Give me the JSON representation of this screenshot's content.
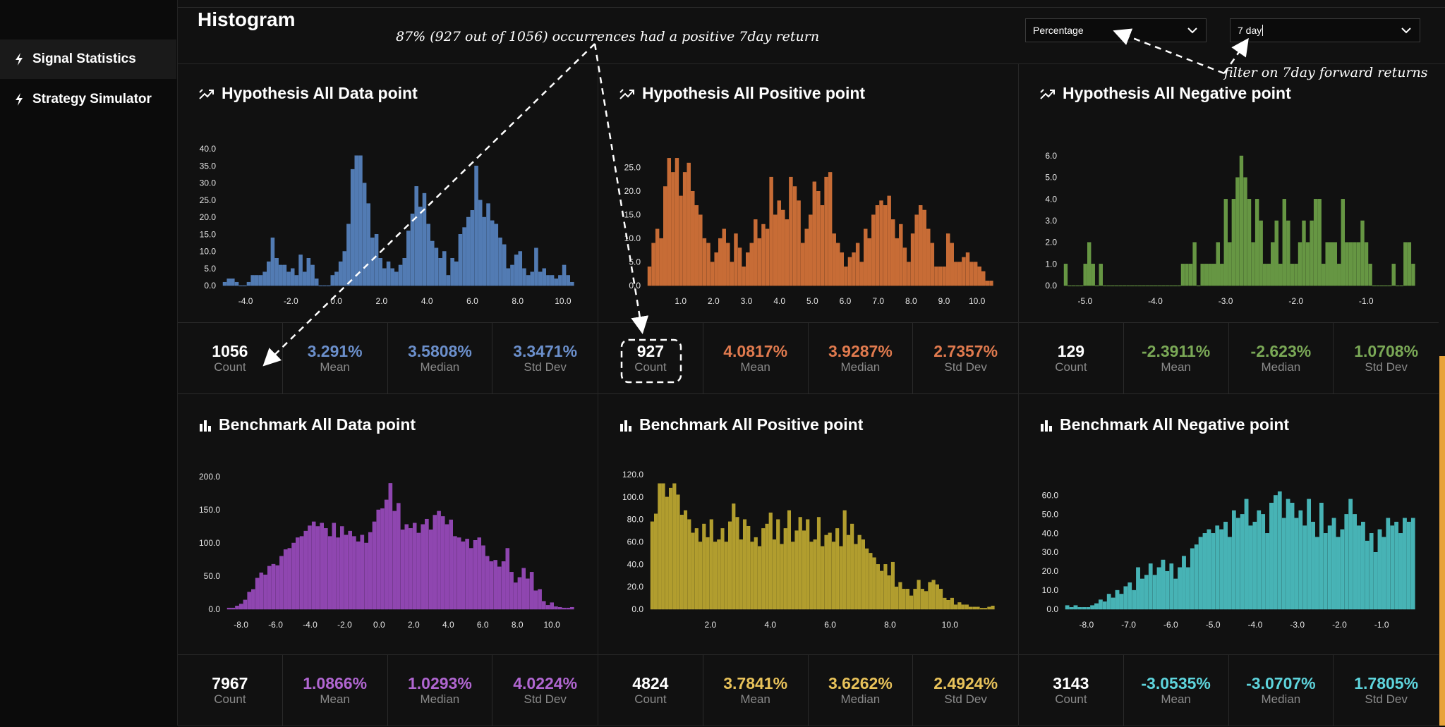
{
  "sidebar": {
    "items": [
      {
        "label": "Signal Statistics",
        "icon": "bolt-icon",
        "active": true
      },
      {
        "label": "Strategy Simulator",
        "icon": "bolt-icon",
        "active": false
      }
    ]
  },
  "header": {
    "title": "Histogram",
    "mode_select": {
      "value": "Percentage"
    },
    "period_select": {
      "value": "7 day"
    }
  },
  "annotations": {
    "occurrences": "87% (927 out of 1056) occurrences had a positive 7day return",
    "filter": "filter on 7day forward returns"
  },
  "colors": {
    "blue": "#5b8ac9",
    "orange": "#e0793b",
    "green": "#72a84a",
    "purple": "#a04dc6",
    "yellow": "#c7b132",
    "cyan": "#4fc9cc",
    "blue_text": "#6b8fcb",
    "orange_text": "#e07a4e",
    "green_text": "#7aa856",
    "purple_text": "#b066d0",
    "yellow_text": "#e8c25a",
    "cyan_text": "#5ed4dc"
  },
  "panels": [
    {
      "title": "Hypothesis All Data point",
      "icon": "trend-icon",
      "stats": {
        "count": "1056",
        "count_label": "Count",
        "mean": "3.291%",
        "mean_label": "Mean",
        "median": "3.5808%",
        "median_label": "Median",
        "std": "3.3471%",
        "std_label": "Std Dev"
      }
    },
    {
      "title": "Hypothesis All Positive point",
      "icon": "trend-icon",
      "stats": {
        "count": "927",
        "count_label": "Count",
        "mean": "4.0817%",
        "mean_label": "Mean",
        "median": "3.9287%",
        "median_label": "Median",
        "std": "2.7357%",
        "std_label": "Std Dev"
      }
    },
    {
      "title": "Hypothesis All Negative point",
      "icon": "trend-icon",
      "stats": {
        "count": "129",
        "count_label": "Count",
        "mean": "-2.3911%",
        "mean_label": "Mean",
        "median": "-2.623%",
        "median_label": "Median",
        "std": "1.0708%",
        "std_label": "Std Dev"
      }
    },
    {
      "title": "Benchmark All Data point",
      "icon": "bar-chart-icon",
      "stats": {
        "count": "7967",
        "count_label": "Count",
        "mean": "1.0866%",
        "mean_label": "Mean",
        "median": "1.0293%",
        "median_label": "Median",
        "std": "4.0224%",
        "std_label": "Std Dev"
      }
    },
    {
      "title": "Benchmark All Positive point",
      "icon": "bar-chart-icon",
      "stats": {
        "count": "4824",
        "count_label": "Count",
        "mean": "3.7841%",
        "mean_label": "Mean",
        "median": "3.6262%",
        "median_label": "Median",
        "std": "2.4924%",
        "std_label": "Std Dev"
      }
    },
    {
      "title": "Benchmark All Negative point",
      "icon": "bar-chart-icon",
      "stats": {
        "count": "3143",
        "count_label": "Count",
        "mean": "-3.0535%",
        "mean_label": "Mean",
        "median": "-3.0707%",
        "median_label": "Median",
        "std": "1.7805%",
        "std_label": "Std Dev"
      }
    }
  ],
  "chart_data": [
    {
      "type": "bar",
      "color": "#5b8ac9",
      "x_range": [
        -5.0,
        10.5
      ],
      "x_ticks": [
        "-4.0",
        "-2.0",
        "0.0",
        "2.0",
        "4.0",
        "6.0",
        "8.0",
        "10.0"
      ],
      "x_tick_values": [
        -4,
        -2,
        0,
        2,
        4,
        6,
        8,
        10
      ],
      "y_ticks": [
        "0.0",
        "5.0",
        "10.0",
        "15.0",
        "20.0",
        "25.0",
        "30.0",
        "35.0",
        "40.0"
      ],
      "y_tick_values": [
        0,
        5,
        10,
        15,
        20,
        25,
        30,
        35,
        40
      ],
      "ylim": [
        0,
        40
      ],
      "values": [
        1,
        2,
        2,
        1,
        0,
        0,
        1,
        3,
        3,
        3,
        4,
        7,
        14,
        8,
        6,
        6,
        4,
        5,
        3,
        9,
        4,
        8,
        6,
        2,
        0,
        0,
        0,
        3,
        4,
        7,
        10,
        18,
        34,
        38,
        38,
        30,
        24,
        14,
        15,
        8,
        5,
        7,
        5,
        4,
        6,
        8,
        16,
        21,
        29,
        23,
        27,
        18,
        13,
        11,
        8,
        10,
        3,
        8,
        7,
        15,
        17,
        20,
        22,
        35,
        25,
        20,
        24,
        19,
        18,
        14,
        12,
        5,
        6,
        9,
        10,
        5,
        3,
        4,
        11,
        4,
        5,
        3,
        3,
        2,
        3,
        6,
        3,
        1
      ]
    },
    {
      "type": "bar",
      "color": "#e0793b",
      "x_range": [
        0.0,
        10.5
      ],
      "x_ticks": [
        "1.0",
        "2.0",
        "3.0",
        "4.0",
        "5.0",
        "6.0",
        "7.0",
        "8.0",
        "9.0",
        "10.0"
      ],
      "x_tick_values": [
        1,
        2,
        3,
        4,
        5,
        6,
        7,
        8,
        9,
        10
      ],
      "y_ticks": [
        "0.0",
        "5.0",
        "10.0",
        "15.0",
        "20.0",
        "25.0"
      ],
      "y_tick_values": [
        0,
        5,
        10,
        15,
        20,
        25
      ],
      "ylim": [
        0,
        27.5
      ],
      "values": [
        4,
        9,
        12,
        10,
        21,
        27,
        24,
        27,
        19,
        24,
        26,
        20,
        17,
        15,
        10,
        9,
        5,
        7,
        10,
        12,
        9,
        5,
        11,
        8,
        4,
        7,
        9,
        14,
        10,
        13,
        12,
        23,
        15,
        18,
        16,
        14,
        23,
        21,
        18,
        9,
        12,
        15,
        22,
        20,
        17,
        23,
        24,
        11,
        9,
        7,
        4,
        6,
        7,
        9,
        5,
        12,
        10,
        15,
        17,
        18,
        17,
        19,
        14,
        10,
        13,
        8,
        5,
        11,
        15,
        17,
        16,
        12,
        9,
        4,
        4,
        4,
        11,
        9,
        5,
        5,
        6,
        7,
        5,
        5,
        4,
        3,
        1,
        1
      ]
    },
    {
      "type": "bar",
      "color": "#72a84a",
      "x_range": [
        -5.3,
        -0.3
      ],
      "x_ticks": [
        "-5.0",
        "-4.0",
        "-3.0",
        "-2.0",
        "-1.0"
      ],
      "x_tick_values": [
        -5,
        -4,
        -3,
        -2,
        -1
      ],
      "y_ticks": [
        "0.0",
        "1.0",
        "2.0",
        "3.0",
        "4.0",
        "5.0",
        "6.0"
      ],
      "y_tick_values": [
        0,
        1,
        2,
        3,
        4,
        5,
        6
      ],
      "ylim": [
        0,
        6
      ],
      "values": [
        1,
        0,
        0,
        0,
        0,
        1,
        2,
        1,
        0,
        1,
        0,
        0,
        0,
        0,
        0,
        0,
        0,
        0,
        0,
        0,
        0,
        0,
        0,
        0,
        0,
        0,
        0,
        0,
        0,
        0,
        1,
        1,
        1,
        2,
        0,
        1,
        1,
        1,
        1,
        2,
        1,
        4,
        2,
        4,
        5,
        6,
        5,
        4,
        2,
        4,
        3,
        1,
        1,
        2,
        3,
        1,
        4,
        3,
        1,
        1,
        2,
        3,
        2,
        3,
        4,
        4,
        1,
        2,
        2,
        2,
        1,
        4,
        2,
        2,
        2,
        2,
        3,
        2,
        1,
        0,
        0,
        0,
        0,
        0,
        1,
        0,
        0,
        2,
        2,
        1
      ]
    },
    {
      "type": "bar",
      "color": "#a04dc6",
      "x_range": [
        -8.8,
        11.3
      ],
      "x_ticks": [
        "-8.0",
        "-6.0",
        "-4.0",
        "-2.0",
        "0.0",
        "2.0",
        "4.0",
        "6.0",
        "8.0",
        "10.0"
      ],
      "x_tick_values": [
        -8,
        -6,
        -4,
        -2,
        0,
        2,
        4,
        6,
        8,
        10
      ],
      "y_ticks": [
        "0.0",
        "50.0",
        "100.0",
        "150.0",
        "200.0"
      ],
      "y_tick_values": [
        0,
        50,
        100,
        150,
        200
      ],
      "ylim": [
        0,
        200
      ],
      "values": [
        2,
        2,
        5,
        8,
        14,
        26,
        30,
        47,
        55,
        52,
        65,
        68,
        66,
        80,
        90,
        92,
        100,
        108,
        110,
        118,
        126,
        132,
        125,
        130,
        122,
        110,
        130,
        108,
        125,
        112,
        118,
        110,
        102,
        112,
        100,
        116,
        132,
        150,
        152,
        165,
        190,
        148,
        160,
        120,
        128,
        122,
        130,
        115,
        128,
        136,
        120,
        142,
        148,
        140,
        128,
        135,
        110,
        108,
        102,
        106,
        92,
        104,
        108,
        96,
        80,
        72,
        74,
        64,
        72,
        92,
        56,
        40,
        48,
        62,
        46,
        56,
        28,
        30,
        12,
        6,
        10,
        4,
        3,
        2,
        2,
        3
      ]
    },
    {
      "type": "bar",
      "color": "#c7b132",
      "x_range": [
        0.0,
        11.5
      ],
      "x_ticks": [
        "2.0",
        "4.0",
        "6.0",
        "8.0",
        "10.0"
      ],
      "x_tick_values": [
        2,
        4,
        6,
        8,
        10
      ],
      "y_ticks": [
        "0.0",
        "20.0",
        "40.0",
        "60.0",
        "80.0",
        "100.0",
        "120.0"
      ],
      "y_tick_values": [
        0,
        20,
        40,
        60,
        80,
        100,
        120
      ],
      "ylim": [
        0,
        120
      ],
      "values": [
        78,
        85,
        112,
        112,
        100,
        108,
        112,
        102,
        84,
        88,
        80,
        68,
        72,
        60,
        76,
        64,
        80,
        60,
        62,
        72,
        60,
        78,
        94,
        82,
        62,
        80,
        74,
        60,
        64,
        56,
        72,
        76,
        86,
        62,
        80,
        58,
        72,
        88,
        60,
        70,
        82,
        70,
        80,
        60,
        62,
        82,
        56,
        66,
        68,
        60,
        72,
        56,
        88,
        66,
        76,
        58,
        66,
        62,
        54,
        50,
        46,
        40,
        34,
        40,
        30,
        42,
        20,
        24,
        18,
        18,
        12,
        18,
        26,
        18,
        16,
        24,
        26,
        22,
        18,
        10,
        8,
        10,
        4,
        6,
        4,
        4,
        2,
        2,
        2,
        1,
        1,
        2,
        3
      ]
    },
    {
      "type": "bar",
      "color": "#4fc9cc",
      "x_range": [
        -8.5,
        -0.2
      ],
      "x_ticks": [
        "-8.0",
        "-7.0",
        "-6.0",
        "-5.0",
        "-4.0",
        "-3.0",
        "-2.0",
        "-1.0"
      ],
      "x_tick_values": [
        -8,
        -7,
        -6,
        -5,
        -4,
        -3,
        -2,
        -1
      ],
      "y_ticks": [
        "0.0",
        "10.0",
        "20.0",
        "30.0",
        "40.0",
        "50.0",
        "60.0"
      ],
      "y_tick_values": [
        0,
        10,
        20,
        30,
        40,
        50,
        60
      ],
      "ylim": [
        0,
        65
      ],
      "values": [
        2,
        1,
        2,
        1,
        1,
        1,
        2,
        3,
        5,
        4,
        8,
        6,
        10,
        8,
        12,
        14,
        10,
        22,
        16,
        18,
        24,
        18,
        22,
        26,
        20,
        24,
        16,
        22,
        28,
        22,
        32,
        34,
        38,
        40,
        42,
        40,
        44,
        42,
        46,
        38,
        52,
        48,
        50,
        58,
        44,
        46,
        52,
        50,
        40,
        56,
        60,
        62,
        48,
        58,
        56,
        48,
        52,
        44,
        58,
        46,
        38,
        56,
        40,
        44,
        48,
        38,
        42,
        50,
        58,
        50,
        44,
        46,
        36,
        40,
        30,
        42,
        38,
        48,
        44,
        46,
        40,
        48,
        46,
        48
      ]
    }
  ]
}
